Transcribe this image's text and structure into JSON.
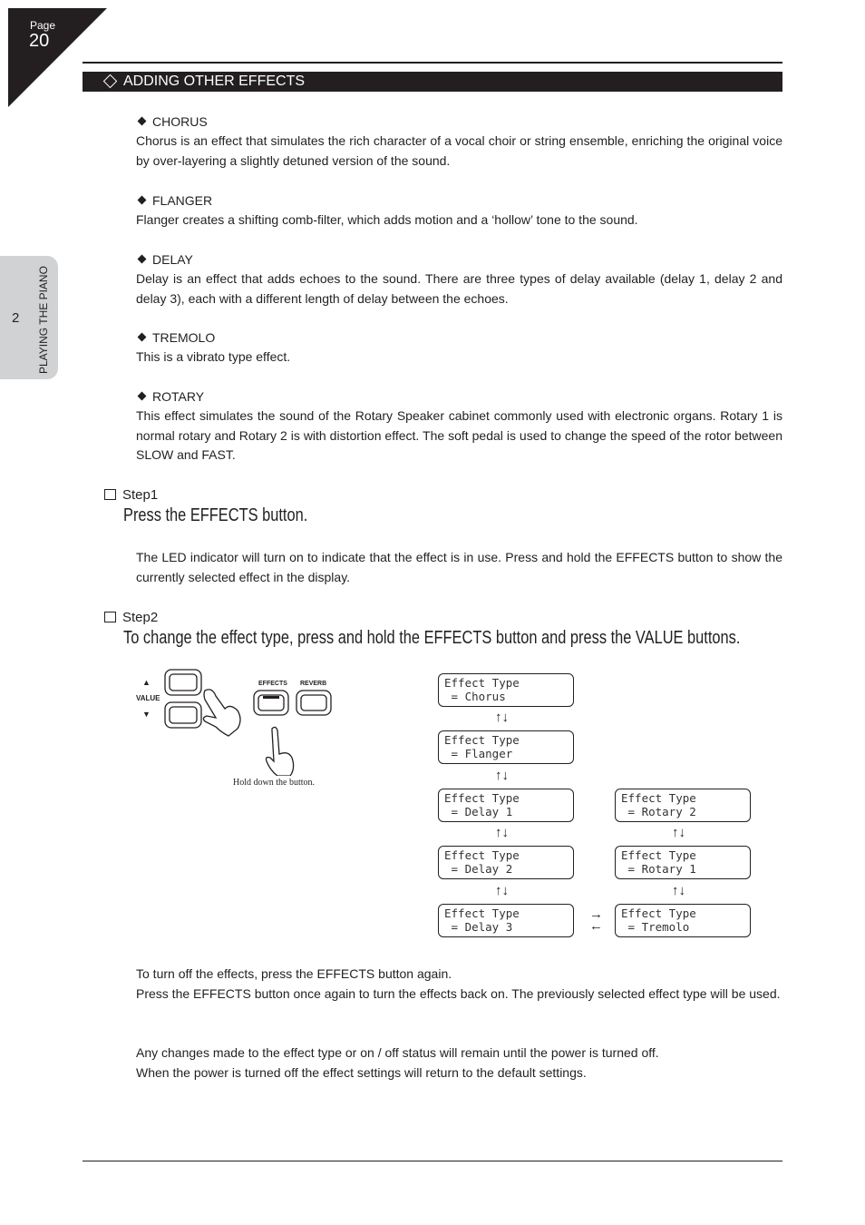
{
  "page": {
    "label": "Page",
    "number": "20"
  },
  "side_tab": {
    "chapter_number": "2",
    "chapter_title": "PLAYING THE PIANO"
  },
  "section": {
    "title": "ADDING OTHER EFFECTS"
  },
  "effects": [
    {
      "name": "CHORUS",
      "description": "Chorus is an effect that simulates the rich character of a vocal choir or string ensemble, enriching the original voice by over-layering a slightly detuned version of the sound."
    },
    {
      "name": "FLANGER",
      "description": "Flanger creates a shifting comb-filter, which adds motion and a ‘hollow’ tone to the sound."
    },
    {
      "name": "DELAY",
      "description": "Delay is an effect that adds echoes to the sound. There are three types of delay available (delay 1, delay 2 and delay 3), each with a different length of delay between the echoes."
    },
    {
      "name": "TREMOLO",
      "description": "This is a vibrato type effect."
    },
    {
      "name": "ROTARY",
      "description": "This effect simulates the sound of the Rotary Speaker cabinet commonly used with electronic organs. Rotary 1 is normal rotary and Rotary 2 is with distortion effect. The soft pedal is used to change the speed of the rotor between SLOW and FAST."
    }
  ],
  "steps": [
    {
      "label": "Step1",
      "instruction": "Press the EFFECTS button.",
      "note": "The LED indicator will turn on to indicate that the effect is in use. Press and hold the EFFECTS button to show the currently selected effect in the display."
    },
    {
      "label": "Step2",
      "instruction": "To change the effect type, press and hold the EFFECTS button and press the VALUE buttons."
    }
  ],
  "panel": {
    "value_label": "VALUE",
    "up": "▲",
    "down": "▼",
    "effects_label": "EFFECTS",
    "reverb_label": "REVERB",
    "caption": "Hold down the button."
  },
  "lcd": [
    {
      "line1": "Effect Type",
      "line2": " = Chorus"
    },
    {
      "line1": "Effect Type",
      "line2": " = Flanger"
    },
    {
      "line1": "Effect Type",
      "line2": " = Delay 1"
    },
    {
      "line1": "Effect Type",
      "line2": " = Delay 2"
    },
    {
      "line1": "Effect Type",
      "line2": " = Delay 3"
    },
    {
      "line1": "Effect Type",
      "line2": " = Rotary 2"
    },
    {
      "line1": "Effect Type",
      "line2": " = Rotary 1"
    },
    {
      "line1": "Effect Type",
      "line2": " = Tremolo"
    }
  ],
  "arrows": {
    "updown": "↑↓",
    "right": "→",
    "left": "←"
  },
  "footer_notes": [
    "To turn off the effects, press the EFFECTS button again.",
    "Press the EFFECTS button once again to turn the effects back on. The previously selected effect type will be used.",
    "Any changes made to the effect type or on / off status will remain until the power is turned off.",
    "When the power is turned off the effect settings will return to the default settings."
  ]
}
